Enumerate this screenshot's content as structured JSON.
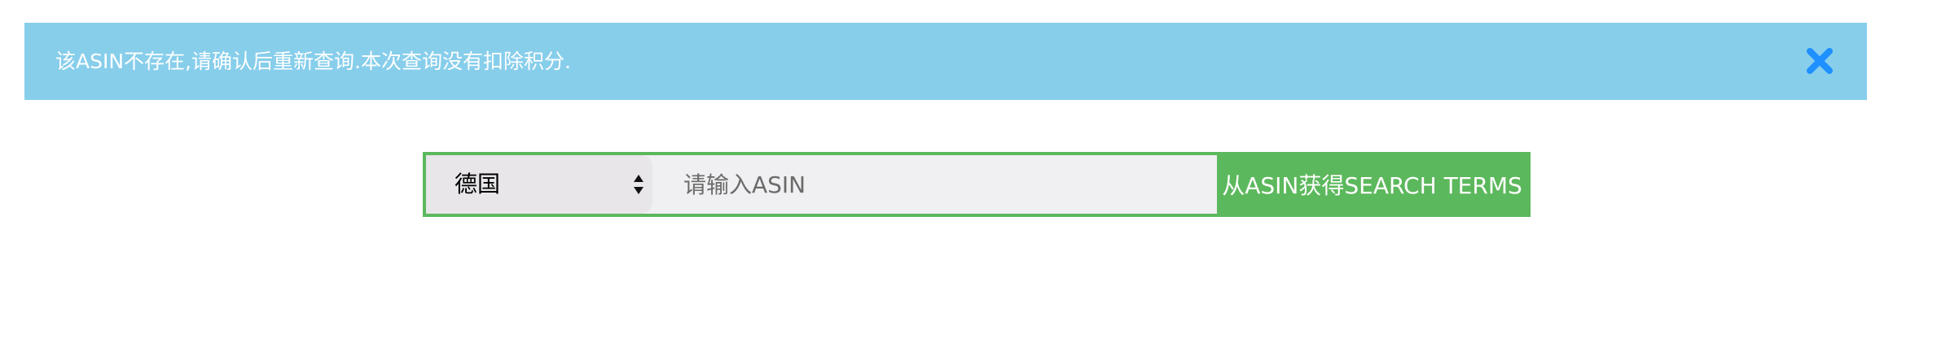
{
  "alert": {
    "message": "该ASIN不存在,请确认后重新查询.本次查询没有扣除积分.",
    "close_icon": "close-icon",
    "background_color": "#87ceeb",
    "close_icon_color": "#1e90ff"
  },
  "search": {
    "country_selected": "德国",
    "country_arrows_icon": "select-updown-icon",
    "asin_placeholder": "请输入ASIN",
    "asin_value": "",
    "submit_label": "从ASIN获得SEARCH TERMS",
    "accent_color": "#5cb85c"
  }
}
